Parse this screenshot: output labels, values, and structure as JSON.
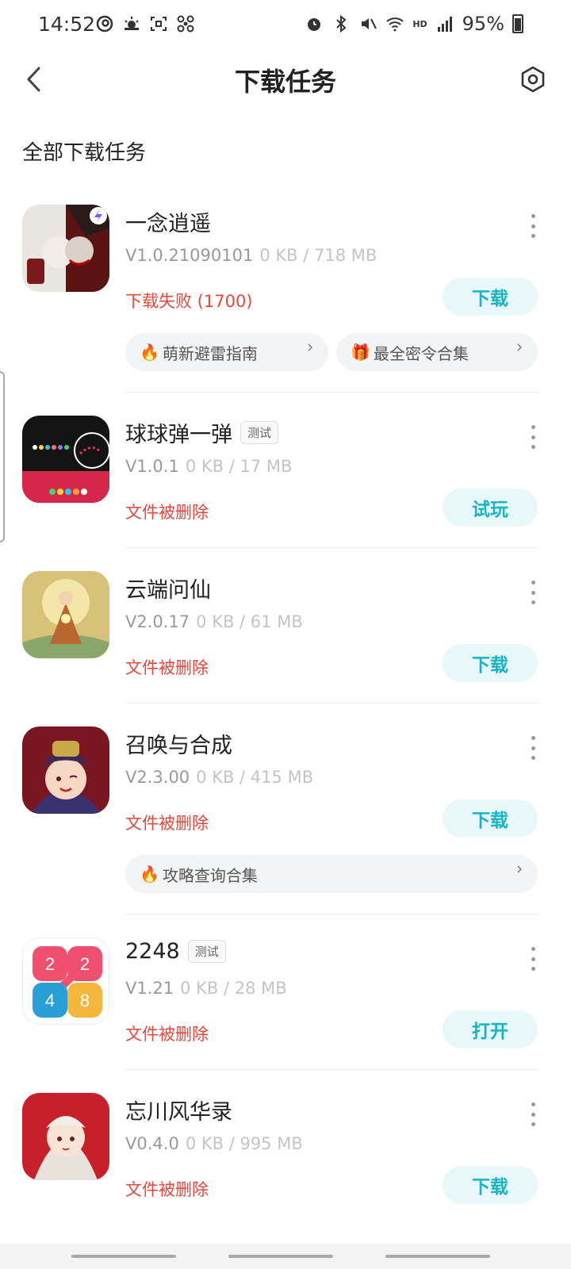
{
  "status_bar": {
    "time": "14:52",
    "battery": "95%",
    "hd": "HD"
  },
  "header": {
    "title": "下载任务"
  },
  "section": {
    "title": "全部下载任务"
  },
  "items": [
    {
      "name": "一念逍遥",
      "tag": "",
      "version": "V1.0.21090101",
      "size": "0 KB / 718 MB",
      "status": "下载失败 (1700)",
      "action": "下载",
      "pills": [
        {
          "emoji": "🔥",
          "label": "萌新避雷指南"
        },
        {
          "emoji": "🎁",
          "label": "最全密令合集"
        }
      ]
    },
    {
      "name": "球球弹一弹",
      "tag": "测试",
      "version": "V1.0.1",
      "size": "0 KB / 17 MB",
      "status": "文件被删除",
      "action": "试玩",
      "pills": []
    },
    {
      "name": "云端问仙",
      "tag": "",
      "version": "V2.0.17",
      "size": "0 KB / 61 MB",
      "status": "文件被删除",
      "action": "下载",
      "pills": []
    },
    {
      "name": "召唤与合成",
      "tag": "",
      "version": "V2.3.00",
      "size": "0 KB / 415 MB",
      "status": "文件被删除",
      "action": "下载",
      "pills": [
        {
          "emoji": "🔥",
          "label": "攻略查询合集"
        }
      ]
    },
    {
      "name": "2248",
      "tag": "测试",
      "version": "V1.21",
      "size": "0 KB / 28 MB",
      "status": "文件被删除",
      "action": "打开",
      "pills": [],
      "icon_text": [
        "2",
        "2",
        "4",
        "8"
      ]
    },
    {
      "name": "忘川风华录",
      "tag": "",
      "version": "V0.4.0",
      "size": "0 KB / 995 MB",
      "status": "文件被删除",
      "action": "下载",
      "pills": []
    }
  ],
  "icons": {
    "back": "chevron-left-icon",
    "settings": "settings-icon",
    "more": "more-vertical-icon"
  },
  "colors": {
    "accent": "#17b4c4",
    "accent_bg": "#e8f7fa",
    "error": "#e8483c"
  }
}
